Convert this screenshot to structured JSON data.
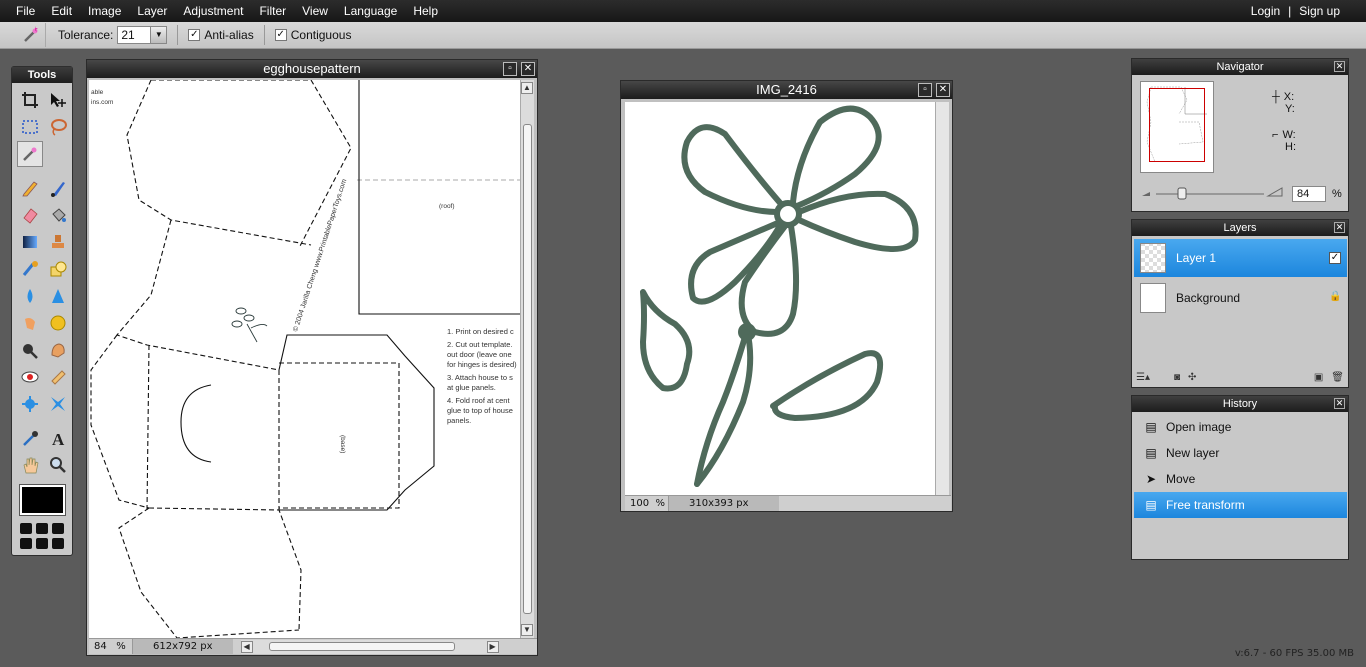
{
  "menu": {
    "items": [
      "File",
      "Edit",
      "Image",
      "Layer",
      "Adjustment",
      "Filter",
      "View",
      "Language",
      "Help"
    ],
    "login": "Login",
    "separator": "|",
    "signup": "Sign up"
  },
  "options": {
    "tolerance_label": "Tolerance:",
    "tolerance_value": "21",
    "antialias_label": "Anti-alias",
    "antialias_checked": true,
    "contiguous_label": "Contiguous",
    "contiguous_checked": true
  },
  "tools": {
    "title": "Tools",
    "selected": "magic-wand",
    "foreground_color": "#000000"
  },
  "doc1": {
    "title": "egghousepattern",
    "zoom": "84",
    "zoom_unit": "%",
    "dims": "612x792 px",
    "fragment_text_1": "able",
    "fragment_text_2": "ins.com",
    "roof_label": "(roof)",
    "base_label": "(base)",
    "side_credit": "© 2004 Jarilla Cheng   www.PrintablePaperToys.com",
    "instructions": [
      "1. Print on desired c",
      "2. Cut out template.",
      "out door (leave one",
      "for hinges is desired)",
      "3. Attach house to s",
      "at glue panels.",
      "4. Fold roof at cent",
      "glue to top of house",
      "panels."
    ]
  },
  "doc2": {
    "title": "IMG_2416",
    "zoom": "100",
    "zoom_unit": "%",
    "dims": "310x393 px"
  },
  "navigator": {
    "title": "Navigator",
    "x_label": "X:",
    "y_label": "Y:",
    "w_label": "W:",
    "h_label": "H:",
    "zoom": "84",
    "zoom_unit": "%"
  },
  "layers": {
    "title": "Layers",
    "items": [
      {
        "name": "Layer 1",
        "selected": true,
        "visible": true
      },
      {
        "name": "Background",
        "selected": false,
        "locked": true
      }
    ]
  },
  "history": {
    "title": "History",
    "items": [
      {
        "name": "Open image",
        "icon": "document-icon"
      },
      {
        "name": "New layer",
        "icon": "document-icon"
      },
      {
        "name": "Move",
        "icon": "move-icon"
      },
      {
        "name": "Free transform",
        "icon": "document-icon",
        "selected": true
      }
    ]
  },
  "footer": "v:6.7 - 60 FPS 35.00 MB",
  "colors": {
    "selection_blue": "#2a8fe3",
    "workspace": "#5b5b5b"
  }
}
